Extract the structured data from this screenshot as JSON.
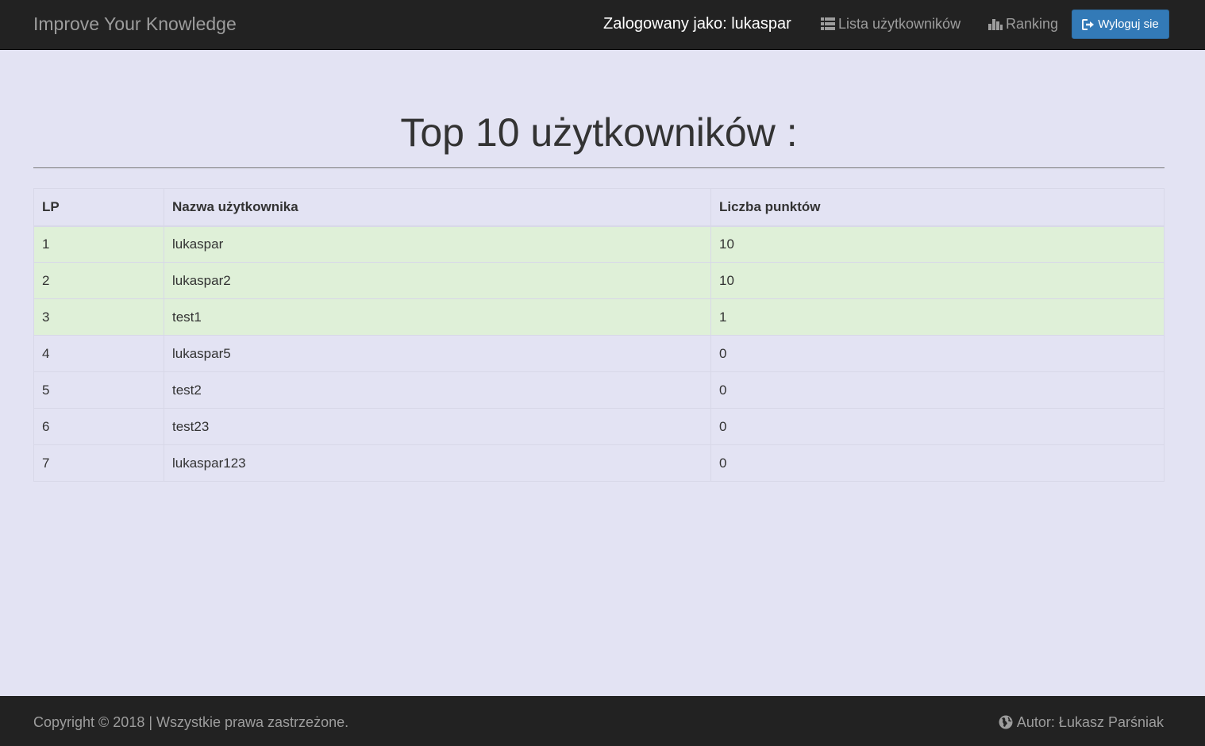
{
  "navbar": {
    "brand": "Improve Your Knowledge",
    "logged_in": "Zalogowany jako: lukaspar",
    "users_list": "Lista użytkowników",
    "users_list_icon": "list-icon",
    "ranking": "Ranking",
    "ranking_icon": "bar-chart-icon",
    "logout": "Wyloguj sie",
    "logout_icon": "logout-icon"
  },
  "main": {
    "title": "Top 10 użytkowników :",
    "table": {
      "headers": [
        "LP",
        "Nazwa użytkownika",
        "Liczba punktów"
      ],
      "rows": [
        {
          "lp": "1",
          "name": "lukaspar",
          "points": "10",
          "highlight": true
        },
        {
          "lp": "2",
          "name": "lukaspar2",
          "points": "10",
          "highlight": true
        },
        {
          "lp": "3",
          "name": "test1",
          "points": "1",
          "highlight": true
        },
        {
          "lp": "4",
          "name": "lukaspar5",
          "points": "0",
          "highlight": false
        },
        {
          "lp": "5",
          "name": "test2",
          "points": "0",
          "highlight": false
        },
        {
          "lp": "6",
          "name": "test23",
          "points": "0",
          "highlight": false
        },
        {
          "lp": "7",
          "name": "lukaspar123",
          "points": "0",
          "highlight": false
        }
      ]
    }
  },
  "footer": {
    "copyright": "Copyright © 2018 | Wszystkie prawa zastrzeżone.",
    "author": "Autor: Łukasz Parśniak",
    "author_icon": "globe-icon"
  },
  "colors": {
    "navbar_bg": "#222222",
    "page_bg": "#e3e3f3",
    "button_primary": "#337ab7",
    "highlight_row": "#dff0d8"
  }
}
